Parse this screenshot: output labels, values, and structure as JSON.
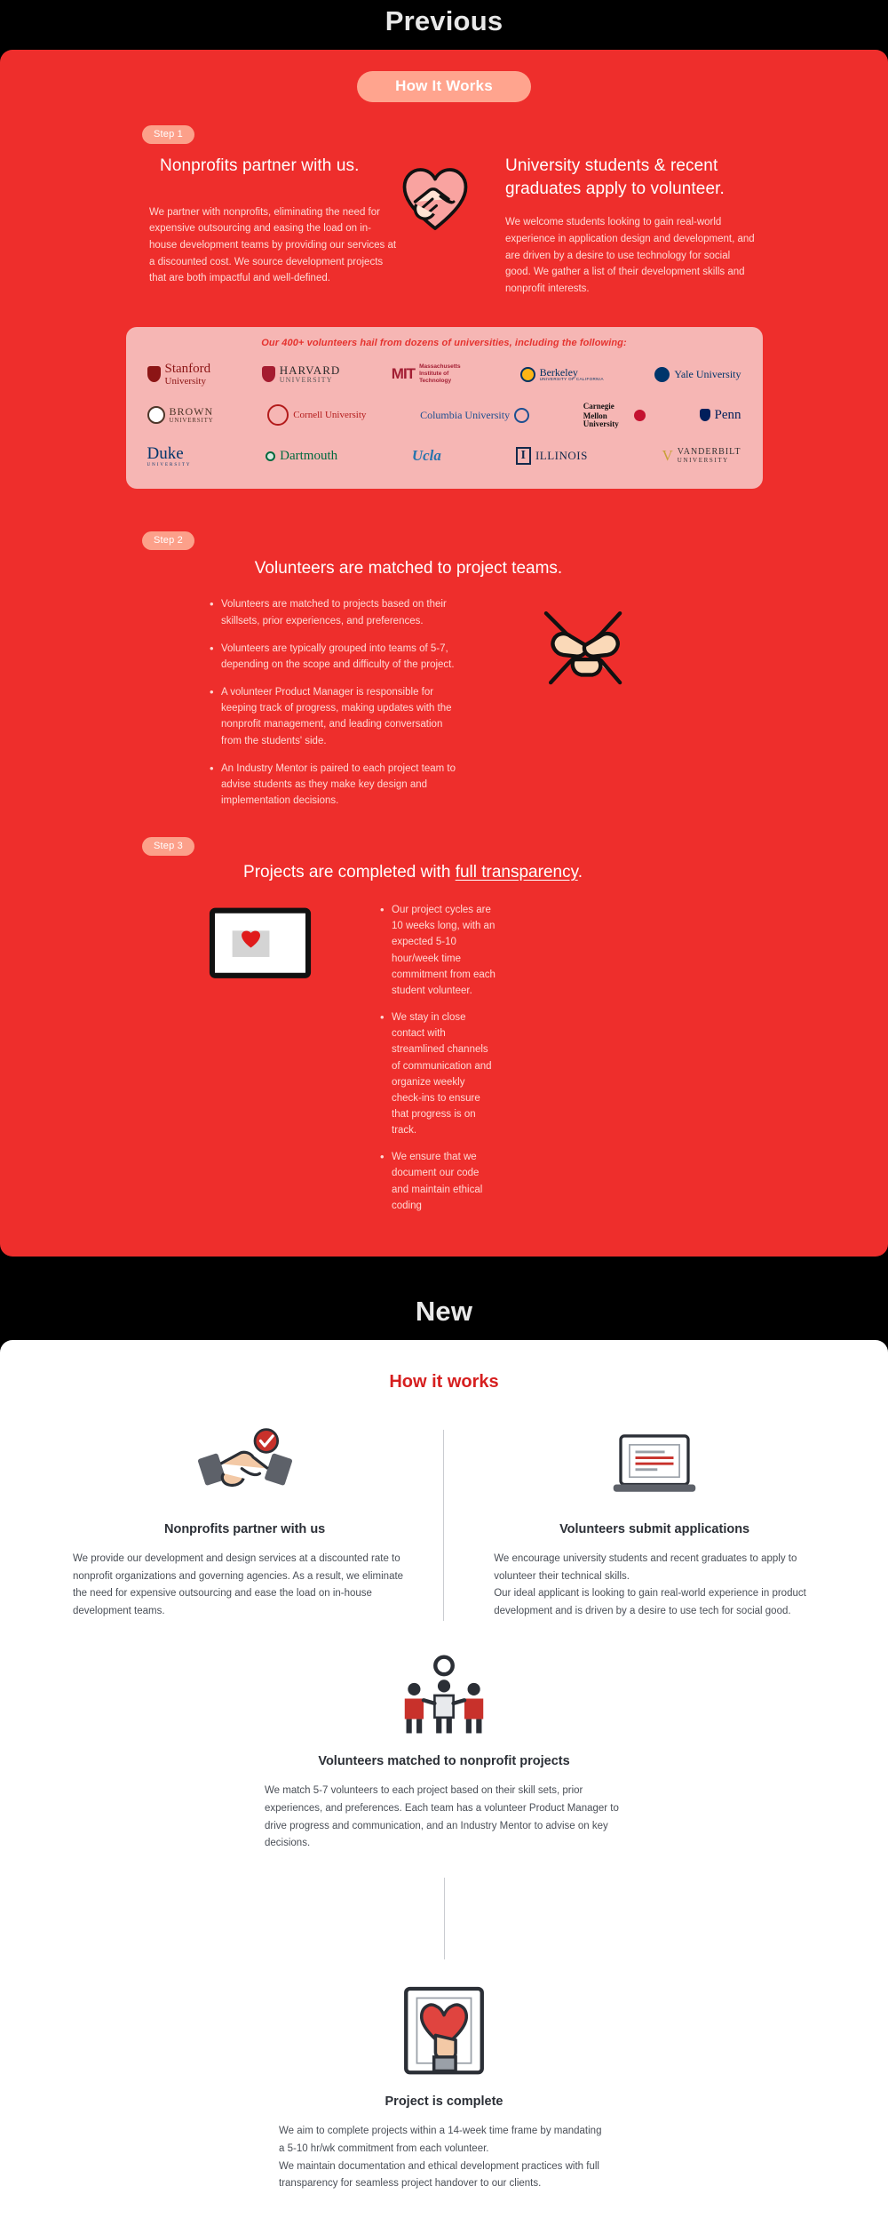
{
  "sections": {
    "previous_label": "Previous",
    "new_label": "New"
  },
  "previous": {
    "badge": "How It Works",
    "step1": {
      "step_label": "Step 1",
      "left_heading": "Nonprofits partner with us.",
      "left_body": "We partner with nonprofits, eliminating the need for expensive outsourcing and easing the load on in-house development teams by providing our services at a discounted cost. We source development projects that are both impactful and well-defined.",
      "right_heading": "University students &  recent graduates apply to volunteer.",
      "right_body": "We welcome students looking to gain real-world experience in application design and development, and are driven by a desire to use technology for social good. We gather a list of their development skills and nonprofit interests.",
      "icon": "handshake-heart-icon"
    },
    "universities": {
      "caption": "Our 400+ volunteers hail from dozens of universities, including the following:",
      "rows": [
        [
          {
            "name": "Stanford University",
            "line1": "Stanford",
            "line2": "University"
          },
          {
            "name": "Harvard University",
            "line1": "HARVARD",
            "line2": "UNIVERSITY"
          },
          {
            "name": "Massachusetts Institute of Technology",
            "line1": "MIT",
            "line2": "Massachusetts Institute of Technology"
          },
          {
            "name": "Berkeley",
            "line1": "Berkeley",
            "line2": "UNIVERSITY OF CALIFORNIA"
          },
          {
            "name": "Yale University",
            "line1": "Yale University",
            "line2": ""
          }
        ],
        [
          {
            "name": "Brown University",
            "line1": "BROWN",
            "line2": "UNIVERSITY"
          },
          {
            "name": "Cornell University",
            "line1": "Cornell University",
            "line2": ""
          },
          {
            "name": "Columbia University",
            "line1": "Columbia University",
            "line2": ""
          },
          {
            "name": "Carnegie Mellon University",
            "line1": "Carnegie Mellon",
            "line2": "University"
          },
          {
            "name": "Penn",
            "line1": "Penn",
            "line2": ""
          }
        ],
        [
          {
            "name": "Duke University",
            "line1": "Duke",
            "line2": "UNIVERSITY"
          },
          {
            "name": "Dartmouth",
            "line1": "Dartmouth",
            "line2": ""
          },
          {
            "name": "UCLA",
            "line1": "Ucla",
            "line2": ""
          },
          {
            "name": "Illinois",
            "line1": "ILLINOIS",
            "line2": ""
          },
          {
            "name": "Vanderbilt University",
            "line1": "VANDERBILT",
            "line2": "UNIVERSITY"
          }
        ]
      ]
    },
    "step2": {
      "step_label": "Step 2",
      "heading": "Volunteers are matched to project teams.",
      "bullets": [
        "Volunteers are matched to projects based on their skillsets, prior experiences, and preferences.",
        "Volunteers are typically grouped into teams of 5-7, depending on the scope and difficulty of the project.",
        "A volunteer Product Manager is responsible for keeping track of progress, making updates with the nonprofit management, and leading conversation from the students' side.",
        "An Industry Mentor is paired to each project team to advise students as they make key design and implementation decisions."
      ],
      "icon": "crossed-hands-icon"
    },
    "step3": {
      "step_label": "Step 3",
      "heading_before": "Projects are completed with ",
      "heading_underlined": "full transparency",
      "heading_after": ".",
      "bullets": [
        "Our project cycles are 10 weeks long, with an expected 5-10 hour/week time commitment from each student volunteer.",
        "We stay in close contact with streamlined channels of communication and organize weekly check-ins to ensure that progress is on track.",
        "We ensure that we document our code and maintain ethical coding"
      ],
      "icon": "laptop-heart-icon"
    }
  },
  "new": {
    "title": "How it works",
    "blocks": [
      {
        "icon": "handshake-check-icon",
        "heading": "Nonprofits partner with us",
        "body": "We provide our development and design services at a discounted rate to nonprofit organizations and governing agencies. As a result, we eliminate the need for expensive outsourcing and ease the load on in-house development teams."
      },
      {
        "icon": "laptop-application-icon",
        "heading": "Volunteers submit applications",
        "body_line1": "We encourage university students and recent graduates to apply to volunteer their technical skills.",
        "body_line2": "Our ideal applicant is looking to gain real-world experience in product development and is driven by a desire to use tech for social good."
      },
      {
        "icon": "team-gear-icon",
        "heading": "Volunteers matched to nonprofit projects",
        "body": "We match 5-7 volunteers to each project based on their skill sets, prior experiences, and preferences. Each team has a volunteer Product Manager to drive progress and communication, and an Industry Mentor to advise on key decisions."
      },
      {
        "icon": "heart-handover-icon",
        "heading": "Project is complete",
        "body_line1": "We aim to complete projects within a 14-week time frame by mandating a 5-10 hr/wk commitment from each volunteer.",
        "body_line2": "We maintain documentation and ethical development practices with full transparency for seamless project handover to our clients."
      }
    ]
  },
  "colors": {
    "red_panel": "#EE2E2C",
    "pill": "#FCA08A",
    "banner": "#F6B6B4",
    "accent_red": "#D61F1F",
    "body_red_text": "#FFD9D4"
  }
}
